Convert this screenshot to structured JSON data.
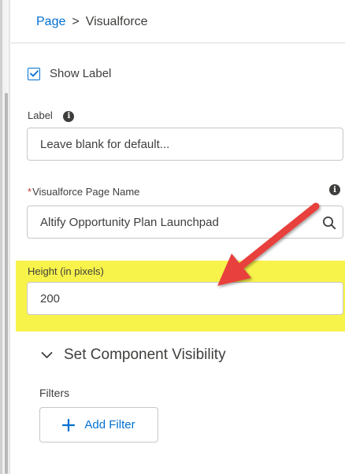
{
  "breadcrumb": {
    "parent": "Page",
    "separator": ">",
    "current": "Visualforce"
  },
  "show_label": {
    "label": "Show Label",
    "checked": true
  },
  "label_field": {
    "label": "Label",
    "placeholder": "Leave blank for default..."
  },
  "vf_page_field": {
    "required_marker": "*",
    "label": "Visualforce Page Name",
    "value": "Altify Opportunity Plan Launchpad"
  },
  "height_field": {
    "label": "Height (in pixels)",
    "value": "200"
  },
  "visibility_section": {
    "title": "Set Component Visibility",
    "filters_label": "Filters",
    "add_filter_label": "Add Filter"
  },
  "annotation": {
    "highlight_color": "#f8f34a",
    "arrow_color": "#e8413c"
  },
  "colors": {
    "link": "#0070d2",
    "text": "#3e3e3c",
    "required": "#c23934",
    "border": "#c9c7c5"
  }
}
